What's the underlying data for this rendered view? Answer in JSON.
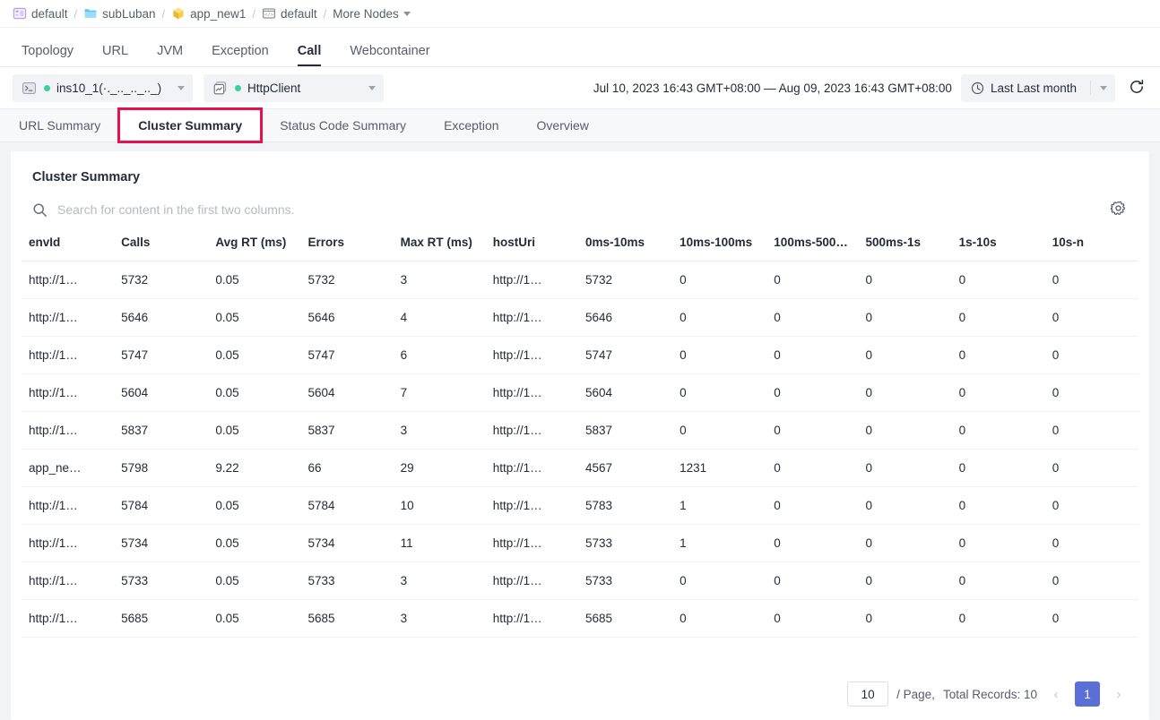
{
  "breadcrumb": {
    "items": [
      {
        "label": "default",
        "icon": "grid-panel-icon"
      },
      {
        "label": "subLuban",
        "icon": "folder-icon"
      },
      {
        "label": "app_new1",
        "icon": "cube-icon"
      },
      {
        "label": "default",
        "icon": "code-window-icon"
      }
    ],
    "separator": "/",
    "more_label": "More Nodes"
  },
  "main_tabs": [
    {
      "label": "Topology",
      "active": false
    },
    {
      "label": "URL",
      "active": false
    },
    {
      "label": "JVM",
      "active": false
    },
    {
      "label": "Exception",
      "active": false
    },
    {
      "label": "Call",
      "active": true
    },
    {
      "label": "Webcontainer",
      "active": false
    }
  ],
  "filter_bar": {
    "instance_selector": {
      "label": "ins10_1(·._.._.._.._)",
      "icon": "terminal-icon",
      "status": "online"
    },
    "client_selector": {
      "label": "HttpClient",
      "icon": "app-window-icon",
      "status": "online"
    },
    "date_range": "Jul 10, 2023 16:43 GMT+08:00 — Aug 09, 2023 16:43 GMT+08:00",
    "time_preset": "Last Last month",
    "clock_icon": "clock-icon",
    "refresh_icon": "refresh-icon"
  },
  "sub_tabs": [
    {
      "label": "URL Summary",
      "active": false,
      "annotated": false
    },
    {
      "label": "Cluster Summary",
      "active": true,
      "annotated": true
    },
    {
      "label": "Status Code Summary",
      "active": false,
      "annotated": false
    },
    {
      "label": "Exception",
      "active": false,
      "annotated": false
    },
    {
      "label": "Overview",
      "active": false,
      "annotated": false
    }
  ],
  "card": {
    "title": "Cluster Summary",
    "search_placeholder": "Search for content in the first two columns.",
    "search_value": "",
    "search_icon": "search-icon",
    "settings_icon": "gear-icon"
  },
  "table": {
    "columns": [
      {
        "key": "envId",
        "label": "envId",
        "type": "plain"
      },
      {
        "key": "calls",
        "label": "Calls",
        "type": "link"
      },
      {
        "key": "avgRt",
        "label": "Avg RT (ms)",
        "type": "link"
      },
      {
        "key": "errors",
        "label": "Errors",
        "type": "link"
      },
      {
        "key": "maxRt",
        "label": "Max RT (ms)",
        "type": "link"
      },
      {
        "key": "hostUri",
        "label": "hostUri",
        "type": "link"
      },
      {
        "key": "b1",
        "label": "0ms-10ms",
        "type": "link"
      },
      {
        "key": "b2",
        "label": "10ms-100ms",
        "type": "link"
      },
      {
        "key": "b3",
        "label": "100ms-500…",
        "type": "link"
      },
      {
        "key": "b4",
        "label": "500ms-1s",
        "type": "link"
      },
      {
        "key": "b5",
        "label": "1s-10s",
        "type": "link"
      },
      {
        "key": "b6",
        "label": "10s-n",
        "type": "link"
      }
    ],
    "rows": [
      {
        "envId": "http://1…",
        "calls": "5732",
        "avgRt": "0.05",
        "errors": "5732",
        "maxRt": "3",
        "hostUri": "http://1…",
        "b1": "5732",
        "b2": "0",
        "b3": "0",
        "b4": "0",
        "b5": "0",
        "b6": "0"
      },
      {
        "envId": "http://1…",
        "calls": "5646",
        "avgRt": "0.05",
        "errors": "5646",
        "maxRt": "4",
        "hostUri": "http://1…",
        "b1": "5646",
        "b2": "0",
        "b3": "0",
        "b4": "0",
        "b5": "0",
        "b6": "0"
      },
      {
        "envId": "http://1…",
        "calls": "5747",
        "avgRt": "0.05",
        "errors": "5747",
        "maxRt": "6",
        "hostUri": "http://1…",
        "b1": "5747",
        "b2": "0",
        "b3": "0",
        "b4": "0",
        "b5": "0",
        "b6": "0"
      },
      {
        "envId": "http://1…",
        "calls": "5604",
        "avgRt": "0.05",
        "errors": "5604",
        "maxRt": "7",
        "hostUri": "http://1…",
        "b1": "5604",
        "b2": "0",
        "b3": "0",
        "b4": "0",
        "b5": "0",
        "b6": "0"
      },
      {
        "envId": "http://1…",
        "calls": "5837",
        "avgRt": "0.05",
        "errors": "5837",
        "maxRt": "3",
        "hostUri": "http://1…",
        "b1": "5837",
        "b2": "0",
        "b3": "0",
        "b4": "0",
        "b5": "0",
        "b6": "0"
      },
      {
        "envId": "app_ne…",
        "calls": "5798",
        "avgRt": "9.22",
        "errors": "66",
        "maxRt": "29",
        "hostUri": "http://1…",
        "b1": "4567",
        "b2": "1231",
        "b3": "0",
        "b4": "0",
        "b5": "0",
        "b6": "0"
      },
      {
        "envId": "http://1…",
        "calls": "5784",
        "avgRt": "0.05",
        "errors": "5784",
        "maxRt": "10",
        "hostUri": "http://1…",
        "b1": "5783",
        "b2": "1",
        "b3": "0",
        "b4": "0",
        "b5": "0",
        "b6": "0"
      },
      {
        "envId": "http://1…",
        "calls": "5734",
        "avgRt": "0.05",
        "errors": "5734",
        "maxRt": "11",
        "hostUri": "http://1…",
        "b1": "5733",
        "b2": "1",
        "b3": "0",
        "b4": "0",
        "b5": "0",
        "b6": "0"
      },
      {
        "envId": "http://1…",
        "calls": "5733",
        "avgRt": "0.05",
        "errors": "5733",
        "maxRt": "3",
        "hostUri": "http://1…",
        "b1": "5733",
        "b2": "0",
        "b3": "0",
        "b4": "0",
        "b5": "0",
        "b6": "0"
      },
      {
        "envId": "http://1…",
        "calls": "5685",
        "avgRt": "0.05",
        "errors": "5685",
        "maxRt": "3",
        "hostUri": "http://1…",
        "b1": "5685",
        "b2": "0",
        "b3": "0",
        "b4": "0",
        "b5": "0",
        "b6": "0"
      }
    ]
  },
  "pagination": {
    "page_size": "10",
    "per_page_label": "/ Page,",
    "total_label": "Total Records: 10",
    "prev_glyph": "‹",
    "next_glyph": "›",
    "current_page": "1"
  },
  "colors": {
    "link": "#5b6fd8",
    "annotation": "#e8114b",
    "status_dot": "#3ecfa0",
    "page_active": "#5b6fd8"
  }
}
